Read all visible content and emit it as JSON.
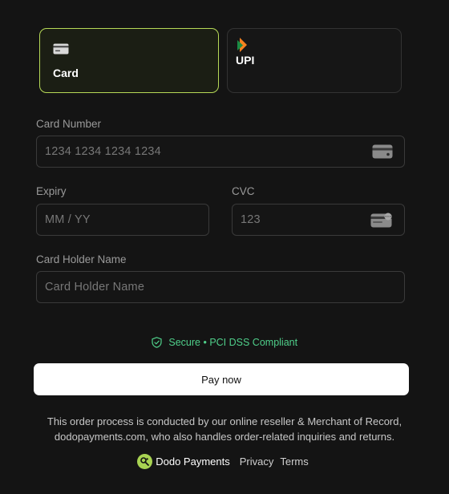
{
  "payment_methods": [
    {
      "label": "Card",
      "icon": "credit-card-icon",
      "selected": true
    },
    {
      "label": "UPI",
      "icon": "upi-logo-icon",
      "selected": false
    }
  ],
  "form": {
    "card_number": {
      "label": "Card Number",
      "placeholder": "1234 1234 1234 1234",
      "icon": "card-brand-icon"
    },
    "expiry": {
      "label": "Expiry",
      "placeholder": "MM / YY"
    },
    "cvc": {
      "label": "CVC",
      "placeholder": "123",
      "icon": "cvc-card-icon"
    },
    "holder": {
      "label": "Card Holder Name",
      "placeholder": "Card Holder Name"
    }
  },
  "secure_text": "Secure • PCI DSS Compliant",
  "pay_button": "Pay now",
  "notice_line1": "This order process is conducted by our online reseller & Merchant of Record,",
  "notice_line2": "dodopayments.com, who also handles order-related inquiries and returns.",
  "footer": {
    "brand": "Dodo Payments",
    "privacy": "Privacy",
    "terms": "Terms"
  },
  "colors": {
    "background": "#141414",
    "accent": "#b6d957",
    "secure": "#4fcf8a",
    "brand_logo": "#a8d352"
  }
}
